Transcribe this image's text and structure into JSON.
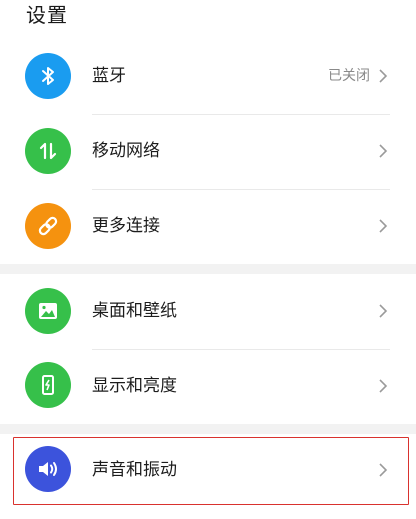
{
  "page_title": "设置",
  "colors": {
    "bluetooth": "#1a9cf0",
    "mobile_network": "#36c04a",
    "more_connections": "#f5920f",
    "wallpaper": "#36c04a",
    "display": "#36c04a",
    "sound": "#3c53dc",
    "highlight_border": "#d9322e"
  },
  "items": [
    {
      "label": "蓝牙",
      "status": "已关闭",
      "icon": "bluetooth-icon"
    },
    {
      "label": "移动网络",
      "status": "",
      "icon": "mobile-data-icon"
    },
    {
      "label": "更多连接",
      "status": "",
      "icon": "link-icon"
    },
    {
      "label": "桌面和壁纸",
      "status": "",
      "icon": "image-icon"
    },
    {
      "label": "显示和亮度",
      "status": "",
      "icon": "phone-brightness-icon"
    },
    {
      "label": "声音和振动",
      "status": "",
      "icon": "speaker-icon"
    }
  ]
}
